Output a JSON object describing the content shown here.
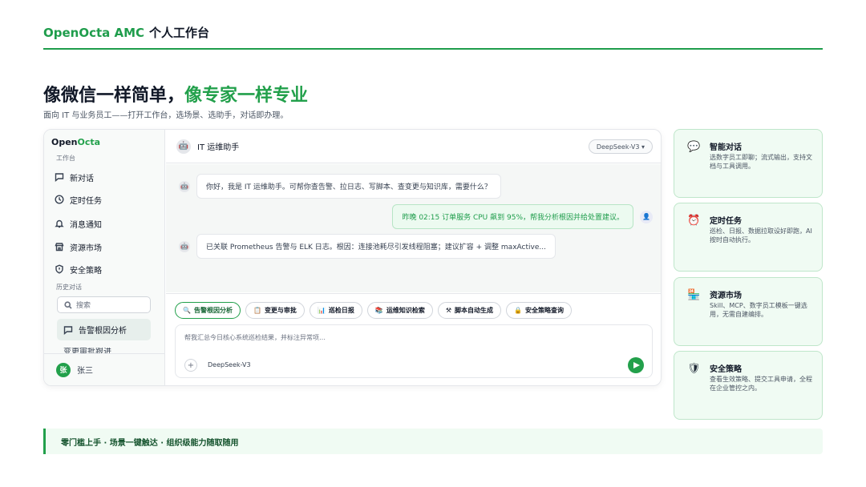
{
  "header": {
    "brand": "OpenOcta AMC",
    "title": "个人工作台"
  },
  "hero": {
    "headline_plain": "像微信一样简单，",
    "headline_accent": "像专家一样专业",
    "subtitle": "面向 IT 与业务员工——打开工作台，选场景、选助手，对话即办理。"
  },
  "sidebar": {
    "logo_a": "Open",
    "logo_b": "Octa",
    "section_label": "工作台",
    "items": [
      {
        "label": "新对话",
        "icon": "chat-icon"
      },
      {
        "label": "定时任务",
        "icon": "clock-icon"
      },
      {
        "label": "消息通知",
        "icon": "bell-icon"
      },
      {
        "label": "资源市场",
        "icon": "store-icon"
      },
      {
        "label": "安全策略",
        "icon": "shield-icon"
      }
    ],
    "history_label": "历史对话",
    "search_placeholder": "搜索",
    "history": [
      {
        "label": "告警根因分析"
      },
      {
        "label": "变更审批跟进"
      }
    ],
    "user": {
      "avatar": "张",
      "name": "张三"
    }
  },
  "chat": {
    "assistant_name": "IT 运维助手",
    "model": "DeepSeek-V3 ▾",
    "messages": [
      {
        "role": "bot",
        "text": "你好，我是 IT 运维助手。可帮你查告警、拉日志、写脚本、查变更与知识库，需要什么？"
      },
      {
        "role": "user",
        "text": "昨晚 02:15 订单服务 CPU 飙到 95%，帮我分析根因并给处置建议。"
      },
      {
        "role": "bot",
        "text": "已关联 Prometheus 告警与 ELK 日志。根因：连接池耗尽引发线程阻塞；建议扩容 + 调整 maxActive..."
      }
    ],
    "chips": [
      {
        "icon": "🔍",
        "label": "告警根因分析"
      },
      {
        "icon": "📋",
        "label": "变更与审批"
      },
      {
        "icon": "📊",
        "label": "巡检日报"
      },
      {
        "icon": "📚",
        "label": "运维知识检索"
      },
      {
        "icon": "⚒",
        "label": "脚本自动生成"
      },
      {
        "icon": "🔒",
        "label": "安全策略查询"
      }
    ],
    "input_placeholder": "帮我汇总今日核心系统巡检结果，并标注异常项…",
    "plus": "+",
    "input_model": "DeepSeek-V3"
  },
  "cards": [
    {
      "icon": "💬",
      "title": "智能对话",
      "desc": "选数字员工即聊；流式输出，支持文档与工具调用。"
    },
    {
      "icon": "⏰",
      "title": "定时任务",
      "desc": "巡检、日报、数据拉取设好即跑，AI 按时自动执行。"
    },
    {
      "icon": "🏪",
      "title": "资源市场",
      "desc": "Skill、MCP、数字员工模板一键选用，无需自建编排。"
    },
    {
      "icon": "🛡",
      "title": "安全策略",
      "desc": "查看生效策略、提交工具申请，全程在企业管控之内。"
    }
  ],
  "footer": {
    "text": "零门槛上手 · 场景一键触达 · 组织级能力随取随用"
  },
  "colors": {
    "accent": "#22a04b",
    "card_bg": "#f0fbf3"
  }
}
